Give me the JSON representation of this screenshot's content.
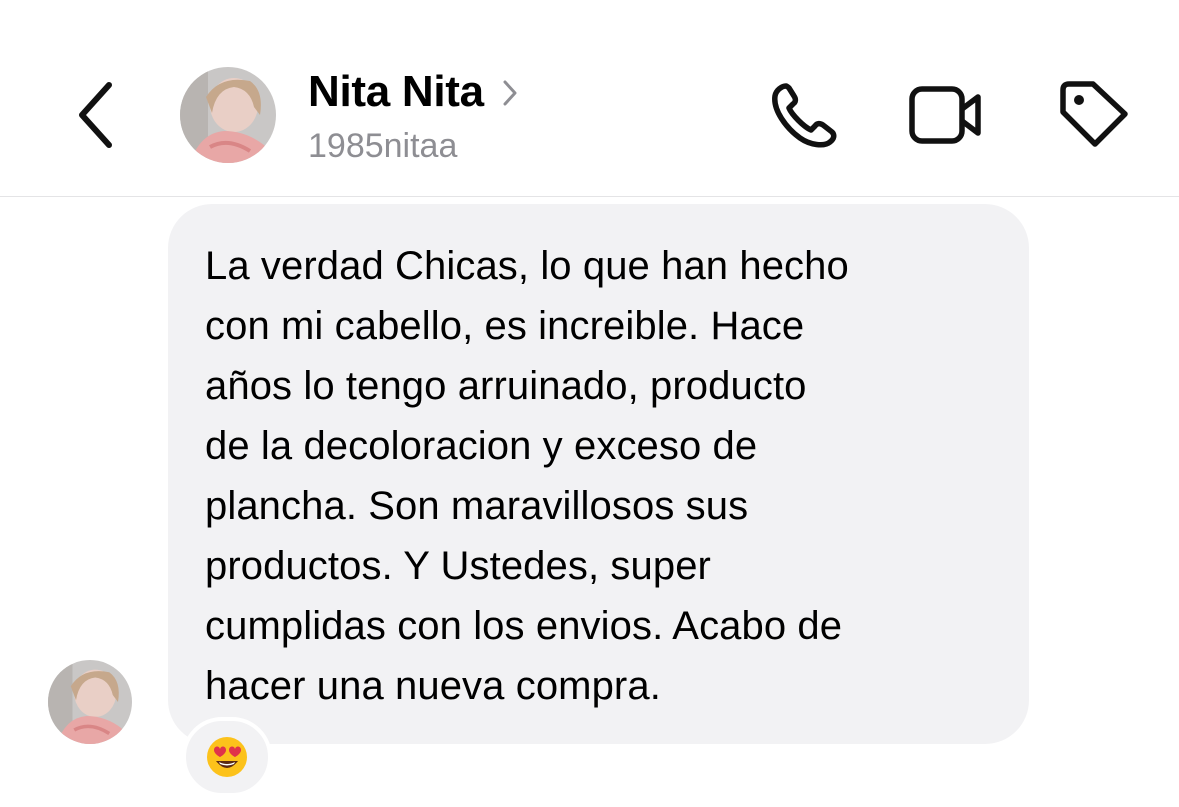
{
  "header": {
    "back_icon": "chevron-left-icon",
    "avatar_icon": "profile-photo",
    "name": "Nita Nita",
    "username": "1985nitaa",
    "actions": [
      "phone-icon",
      "video-camera-icon",
      "tag-icon"
    ]
  },
  "message": {
    "text": "La verdad Chicas, lo que han hecho\ncon mi cabello, es increible. Hace\naños lo tengo arruinado, producto\nde la decoloracion y exceso de\nplancha. Son maravillosos sus\nproductos. Y Ustedes, super\ncumplidas con los envios. Acabo de\nhacer una nueva compra.",
    "reaction": "heart-eyes-emoji"
  },
  "colors": {
    "bubble_bg": "#f2f2f4",
    "secondary_text": "#8e8e93",
    "divider": "#e4e4e6"
  }
}
